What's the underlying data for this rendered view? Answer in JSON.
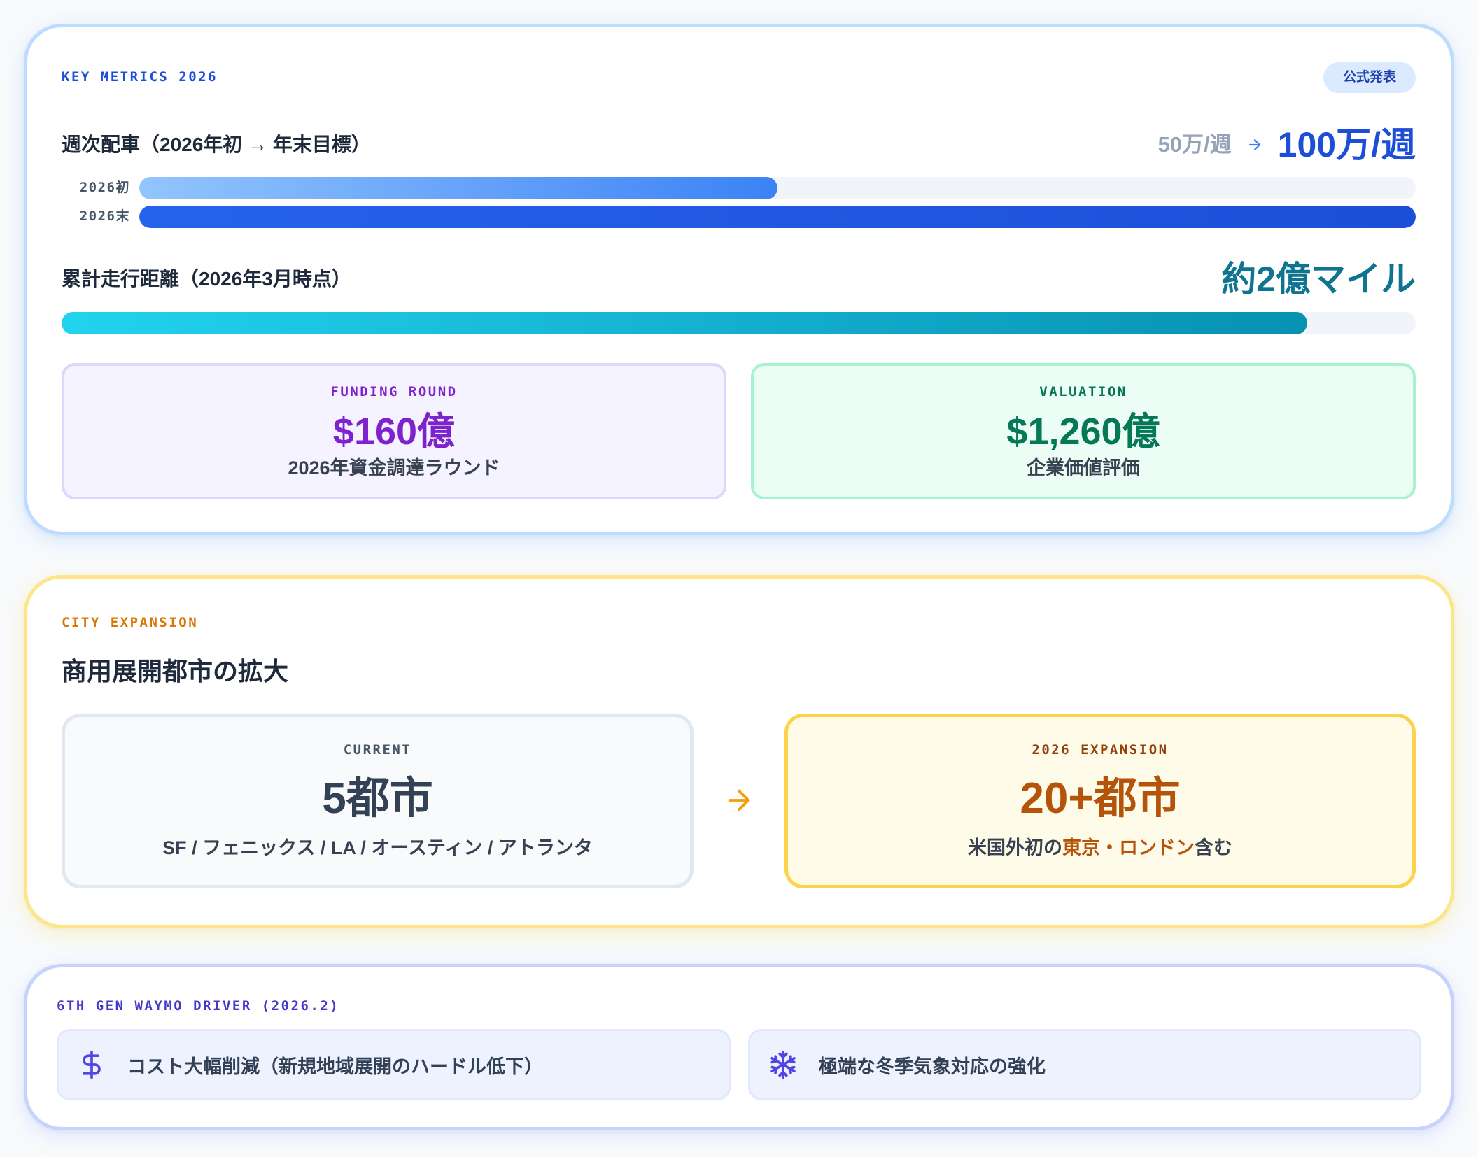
{
  "colors": {
    "page_bg": "#f8fafc",
    "metrics_border": "#bfdbfe",
    "metrics_accent": "#1d4ed8",
    "mileage_accent": "#0e7490",
    "funding_accent": "#7e22ce",
    "valuation_accent": "#047857",
    "city_border": "#fde68a",
    "city_accent": "#d97706",
    "city_arrow": "#f59e0b",
    "expansion_border": "#fcd34d",
    "expansion_accent": "#b45309",
    "driver_border": "#c7d2fe",
    "driver_accent": "#4338ca",
    "feature_icon": "#4f46e5"
  },
  "metrics": {
    "section_label": "KEY METRICS 2026",
    "badge": "公式発表",
    "weekly_rides": {
      "title": "週次配車（2026年初 → 年末目標）",
      "start_value": "50万/週",
      "arrow_icon": "arrow-right-icon",
      "target_value": "100万/週",
      "bars": [
        {
          "label": "2026初",
          "fill": 0.5
        },
        {
          "label": "2026末",
          "fill": 1.0
        }
      ]
    },
    "cumulative_miles": {
      "title": "累計走行距離（2026年3月時点）",
      "value": "約2億マイル",
      "fill": 0.92
    },
    "funding": {
      "label": "FUNDING ROUND",
      "value": "$160億",
      "caption": "2026年資金調達ラウンド"
    },
    "valuation": {
      "label": "VALUATION",
      "value": "$1,260億",
      "caption": "企業価値評価"
    }
  },
  "cities": {
    "section_label": "CITY EXPANSION",
    "title": "商用展開都市の拡大",
    "arrow_icon": "arrow-right-icon",
    "current": {
      "label": "CURRENT",
      "value": "5都市",
      "caption": "SF / フェニックス / LA / オースティン / アトランタ"
    },
    "expansion": {
      "label": "2026 EXPANSION",
      "value": "20+都市",
      "caption_prefix": "米国外初の",
      "caption_highlight": "東京・ロンドン",
      "caption_suffix": "含む"
    }
  },
  "driver": {
    "section_label": "6TH GEN WAYMO DRIVER (2026.2)",
    "features": [
      {
        "icon": "dollar-icon",
        "text": "コスト大幅削減（新規地域展開のハードル低下）"
      },
      {
        "icon": "snowflake-icon",
        "text": "極端な冬季気象対応の強化"
      }
    ]
  }
}
